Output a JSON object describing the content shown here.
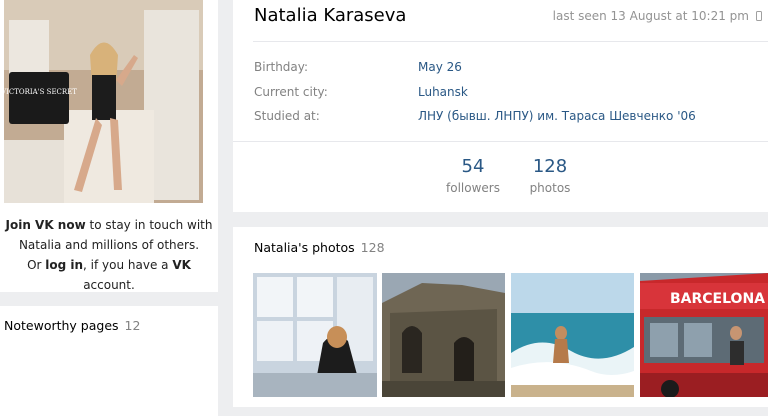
{
  "profile": {
    "name": "Natalia Karaseva",
    "last_seen": "last seen 13 August at 10:21 pm",
    "info": [
      {
        "label": "Birthday:",
        "value": "May 26"
      },
      {
        "label": "Current city:",
        "value": "Luhansk"
      },
      {
        "label": "Studied at:",
        "value": "ЛНУ (бывш. ЛНПУ) им. Тараса Шевченко '06"
      }
    ],
    "counters": [
      {
        "number": "54",
        "label": "followers"
      },
      {
        "number": "128",
        "label": "photos"
      }
    ]
  },
  "join": {
    "join_link": "Join VK now",
    "line1_rest": " to stay in touch with",
    "line2": "Natalia and millions of others.",
    "line3_pre": "Or ",
    "login_link": "log in",
    "line3_mid": ", if you have a ",
    "vk": "VK",
    "line3_end": " account."
  },
  "noteworthy": {
    "title": "Noteworthy pages",
    "count": "12"
  },
  "photos": {
    "title": "Natalia's photos",
    "count": "128"
  },
  "avatar_bag_text": "VICTORIA'S SECRET",
  "thumb_bus_text": "BARCELONA",
  "colors": {
    "link": "#2a5885",
    "muted": "#828282",
    "background": "#edeef0"
  }
}
